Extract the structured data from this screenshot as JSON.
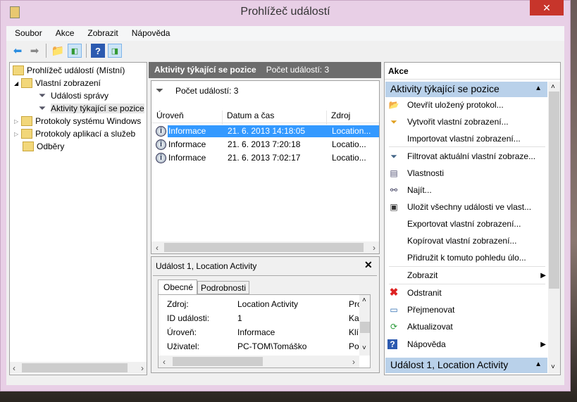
{
  "window": {
    "title": "Prohlížeč událostí",
    "close": "✕"
  },
  "menu": [
    "Soubor",
    "Akce",
    "Zobrazit",
    "Nápověda"
  ],
  "tree": {
    "root": "Prohlížeč událostí (Místní)",
    "items": [
      "Vlastní zobrazení",
      "Události správy",
      "Aktivity týkající se pozice",
      "Protokoly systému Windows",
      "Protokoly aplikací a služeb",
      "Odběry"
    ]
  },
  "middle": {
    "header_title": "Aktivity týkající se pozice",
    "header_count": "Počet událostí: 3",
    "filter_count": "Počet událostí: 3",
    "columns": [
      "Úroveň",
      "Datum a čas",
      "Zdroj"
    ],
    "rows": [
      [
        "Informace",
        "21. 6. 2013 14:18:05",
        "Location..."
      ],
      [
        "Informace",
        "21. 6. 2013 7:20:18",
        "Locatio..."
      ],
      [
        "Informace",
        "21. 6. 2013 7:02:17",
        "Locatio..."
      ]
    ]
  },
  "detail": {
    "title": "Událost 1, Location Activity",
    "tabs": [
      "Obecné",
      "Podrobnosti"
    ],
    "fields": [
      [
        "Zdroj:",
        "Location Activity",
        "Pro"
      ],
      [
        "ID události:",
        "1",
        "Ka"
      ],
      [
        "Úroveň:",
        "Informace",
        "Klí"
      ],
      [
        "Uživatel:",
        "PC-TOM\\Tomáško",
        "Po"
      ]
    ]
  },
  "actions": {
    "title": "Akce",
    "group1": "Aktivity týkající se pozice",
    "group2": "Událost 1, Location Activity",
    "items": [
      "Otevřít uložený protokol...",
      "Vytvořit vlastní zobrazení...",
      "Importovat vlastní zobrazení...",
      "Filtrovat aktuální vlastní zobraze...",
      "Vlastnosti",
      "Najít...",
      "Uložit všechny události ve vlast...",
      "Exportovat vlastní zobrazení...",
      "Kopírovat vlastní zobrazení...",
      "Přidružit k tomuto pohledu úlo...",
      "Zobrazit",
      "Odstranit",
      "Přejmenovat",
      "Aktualizovat",
      "Nápověda"
    ]
  }
}
